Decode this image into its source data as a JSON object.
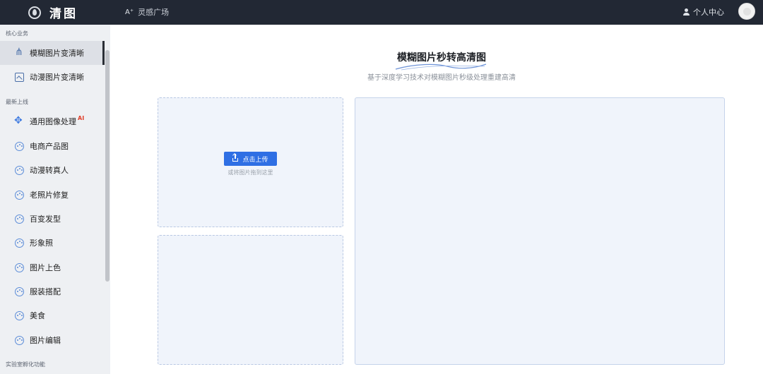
{
  "header": {
    "logo_text": "清图",
    "nav_inspire": "灵感广场",
    "ai_mark": "A⁺",
    "user_center": "个人中心"
  },
  "sidebar": {
    "sections": [
      {
        "title": "核心业务"
      },
      {
        "title": "最新上线"
      },
      {
        "title": "实验室孵化功能"
      }
    ],
    "items": [
      {
        "label": "模糊图片变清晰",
        "icon": "enhance-icon",
        "active": true
      },
      {
        "label": "动漫图片变清晰",
        "icon": "image-icon"
      },
      {
        "label": "通用图像处理",
        "icon": "move-icon",
        "badge": "AI"
      },
      {
        "label": "电商产品图",
        "icon": "palette-icon"
      },
      {
        "label": "动漫转真人",
        "icon": "palette-icon"
      },
      {
        "label": "老照片修复",
        "icon": "palette-icon"
      },
      {
        "label": "百变发型",
        "icon": "palette-icon"
      },
      {
        "label": "形象照",
        "icon": "palette-icon"
      },
      {
        "label": "图片上色",
        "icon": "palette-icon"
      },
      {
        "label": "服装搭配",
        "icon": "palette-icon"
      },
      {
        "label": "美食",
        "icon": "palette-icon"
      },
      {
        "label": "图片编辑",
        "icon": "palette-icon"
      }
    ]
  },
  "main": {
    "title": "模糊图片秒转高清图",
    "subtitle": "基于深度学习技术对模糊图片秒级处理重建高清",
    "upload_button": "点击上传",
    "drag_hint": "或将图片拖到这里"
  },
  "colors": {
    "topbar": "#222834",
    "accent": "#2f6fe4",
    "panel_bg": "#f0f4fb",
    "sidebar_bg": "#eef0f3",
    "ai_badge": "#e0412b"
  }
}
